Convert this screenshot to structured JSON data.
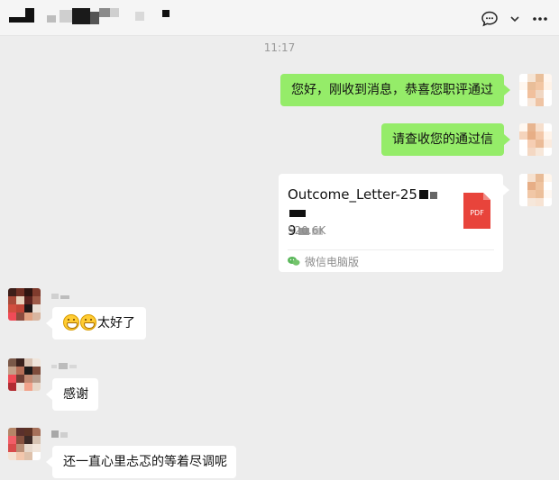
{
  "header": {
    "title": "",
    "actions": {
      "chat_icon": "chat-bubble-icon",
      "dropdown_icon": "chevron-down-icon",
      "more_icon": "more-icon"
    }
  },
  "chat": {
    "timestamp": "11:17",
    "messages": [
      {
        "direction": "outgoing",
        "type": "text",
        "text": "您好，刚收到消息，恭喜您职评通过"
      },
      {
        "direction": "outgoing",
        "type": "text",
        "text": "请查收您的通过信"
      },
      {
        "direction": "outgoing",
        "type": "file",
        "file_name": "Outcome_Letter-25",
        "file_name_tail": "9",
        "file_size": "520.6K",
        "file_type": "PDF",
        "source": "微信电脑版"
      },
      {
        "direction": "incoming",
        "type": "text",
        "text": "太好了",
        "emoji": [
          "grin-emoji",
          "grin-emoji"
        ]
      },
      {
        "direction": "incoming",
        "type": "text",
        "text": "感谢"
      },
      {
        "direction": "incoming",
        "type": "text",
        "text": "还一直心里忐忑的等着尽调呢"
      }
    ]
  },
  "colors": {
    "outgoing_bubble": "#95ec69",
    "incoming_bubble": "#ffffff",
    "background": "#ededed",
    "pdf_red": "#e8443b"
  }
}
